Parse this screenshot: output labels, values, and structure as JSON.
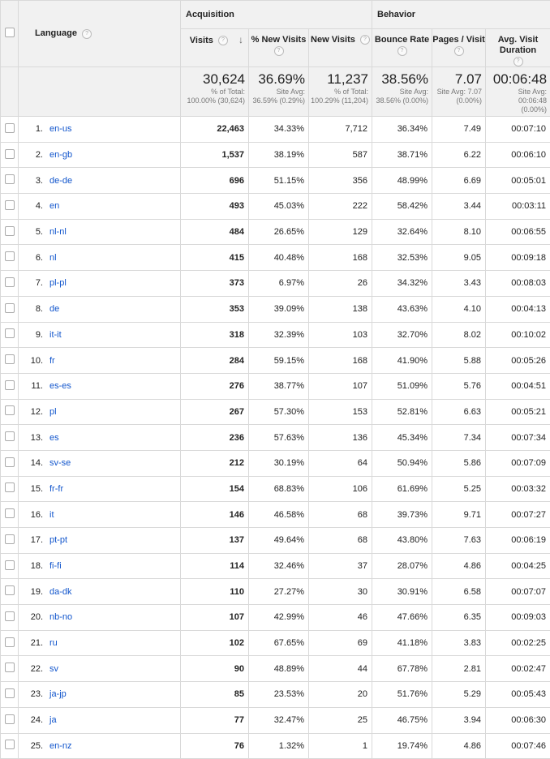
{
  "header": {
    "language": "Language",
    "acquisition": "Acquisition",
    "behavior": "Behavior",
    "visits": "Visits",
    "pct_new_visits": "% New Visits",
    "new_visits": "New Visits",
    "bounce_rate": "Bounce Rate",
    "pages_visit": "Pages / Visit",
    "avg_duration": "Avg. Visit Duration",
    "help_glyph": "?",
    "sort_glyph": "↓"
  },
  "totals": {
    "visits": {
      "big": "30,624",
      "l1": "% of Total:",
      "l2": "100.00% (30,624)"
    },
    "pct_new": {
      "big": "36.69%",
      "l1": "Site Avg:",
      "l2": "36.59% (0.29%)"
    },
    "new_visits": {
      "big": "11,237",
      "l1": "% of Total:",
      "l2": "100.29% (11,204)"
    },
    "bounce": {
      "big": "38.56%",
      "l1": "Site Avg:",
      "l2": "38.56% (0.00%)"
    },
    "pages": {
      "big": "7.07",
      "l1": "Site Avg: 7.07",
      "l2": "(0.00%)"
    },
    "duration": {
      "big": "00:06:48",
      "l1": "Site Avg:",
      "l2": "00:06:48",
      "l3": "(0.00%)"
    }
  },
  "rows": [
    {
      "n": "1.",
      "lang": "en-us",
      "visits": "22,463",
      "pct": "34.33%",
      "new": "7,712",
      "bounce": "36.34%",
      "pages": "7.49",
      "dur": "00:07:10"
    },
    {
      "n": "2.",
      "lang": "en-gb",
      "visits": "1,537",
      "pct": "38.19%",
      "new": "587",
      "bounce": "38.71%",
      "pages": "6.22",
      "dur": "00:06:10"
    },
    {
      "n": "3.",
      "lang": "de-de",
      "visits": "696",
      "pct": "51.15%",
      "new": "356",
      "bounce": "48.99%",
      "pages": "6.69",
      "dur": "00:05:01"
    },
    {
      "n": "4.",
      "lang": "en",
      "visits": "493",
      "pct": "45.03%",
      "new": "222",
      "bounce": "58.42%",
      "pages": "3.44",
      "dur": "00:03:11"
    },
    {
      "n": "5.",
      "lang": "nl-nl",
      "visits": "484",
      "pct": "26.65%",
      "new": "129",
      "bounce": "32.64%",
      "pages": "8.10",
      "dur": "00:06:55"
    },
    {
      "n": "6.",
      "lang": "nl",
      "visits": "415",
      "pct": "40.48%",
      "new": "168",
      "bounce": "32.53%",
      "pages": "9.05",
      "dur": "00:09:18"
    },
    {
      "n": "7.",
      "lang": "pl-pl",
      "visits": "373",
      "pct": "6.97%",
      "new": "26",
      "bounce": "34.32%",
      "pages": "3.43",
      "dur": "00:08:03"
    },
    {
      "n": "8.",
      "lang": "de",
      "visits": "353",
      "pct": "39.09%",
      "new": "138",
      "bounce": "43.63%",
      "pages": "4.10",
      "dur": "00:04:13"
    },
    {
      "n": "9.",
      "lang": "it-it",
      "visits": "318",
      "pct": "32.39%",
      "new": "103",
      "bounce": "32.70%",
      "pages": "8.02",
      "dur": "00:10:02"
    },
    {
      "n": "10.",
      "lang": "fr",
      "visits": "284",
      "pct": "59.15%",
      "new": "168",
      "bounce": "41.90%",
      "pages": "5.88",
      "dur": "00:05:26"
    },
    {
      "n": "11.",
      "lang": "es-es",
      "visits": "276",
      "pct": "38.77%",
      "new": "107",
      "bounce": "51.09%",
      "pages": "5.76",
      "dur": "00:04:51"
    },
    {
      "n": "12.",
      "lang": "pl",
      "visits": "267",
      "pct": "57.30%",
      "new": "153",
      "bounce": "52.81%",
      "pages": "6.63",
      "dur": "00:05:21"
    },
    {
      "n": "13.",
      "lang": "es",
      "visits": "236",
      "pct": "57.63%",
      "new": "136",
      "bounce": "45.34%",
      "pages": "7.34",
      "dur": "00:07:34"
    },
    {
      "n": "14.",
      "lang": "sv-se",
      "visits": "212",
      "pct": "30.19%",
      "new": "64",
      "bounce": "50.94%",
      "pages": "5.86",
      "dur": "00:07:09"
    },
    {
      "n": "15.",
      "lang": "fr-fr",
      "visits": "154",
      "pct": "68.83%",
      "new": "106",
      "bounce": "61.69%",
      "pages": "5.25",
      "dur": "00:03:32"
    },
    {
      "n": "16.",
      "lang": "it",
      "visits": "146",
      "pct": "46.58%",
      "new": "68",
      "bounce": "39.73%",
      "pages": "9.71",
      "dur": "00:07:27"
    },
    {
      "n": "17.",
      "lang": "pt-pt",
      "visits": "137",
      "pct": "49.64%",
      "new": "68",
      "bounce": "43.80%",
      "pages": "7.63",
      "dur": "00:06:19"
    },
    {
      "n": "18.",
      "lang": "fi-fi",
      "visits": "114",
      "pct": "32.46%",
      "new": "37",
      "bounce": "28.07%",
      "pages": "4.86",
      "dur": "00:04:25"
    },
    {
      "n": "19.",
      "lang": "da-dk",
      "visits": "110",
      "pct": "27.27%",
      "new": "30",
      "bounce": "30.91%",
      "pages": "6.58",
      "dur": "00:07:07"
    },
    {
      "n": "20.",
      "lang": "nb-no",
      "visits": "107",
      "pct": "42.99%",
      "new": "46",
      "bounce": "47.66%",
      "pages": "6.35",
      "dur": "00:09:03"
    },
    {
      "n": "21.",
      "lang": "ru",
      "visits": "102",
      "pct": "67.65%",
      "new": "69",
      "bounce": "41.18%",
      "pages": "3.83",
      "dur": "00:02:25"
    },
    {
      "n": "22.",
      "lang": "sv",
      "visits": "90",
      "pct": "48.89%",
      "new": "44",
      "bounce": "67.78%",
      "pages": "2.81",
      "dur": "00:02:47"
    },
    {
      "n": "23.",
      "lang": "ja-jp",
      "visits": "85",
      "pct": "23.53%",
      "new": "20",
      "bounce": "51.76%",
      "pages": "5.29",
      "dur": "00:05:43"
    },
    {
      "n": "24.",
      "lang": "ja",
      "visits": "77",
      "pct": "32.47%",
      "new": "25",
      "bounce": "46.75%",
      "pages": "3.94",
      "dur": "00:06:30"
    },
    {
      "n": "25.",
      "lang": "en-nz",
      "visits": "76",
      "pct": "1.32%",
      "new": "1",
      "bounce": "19.74%",
      "pages": "4.86",
      "dur": "00:07:46"
    }
  ]
}
